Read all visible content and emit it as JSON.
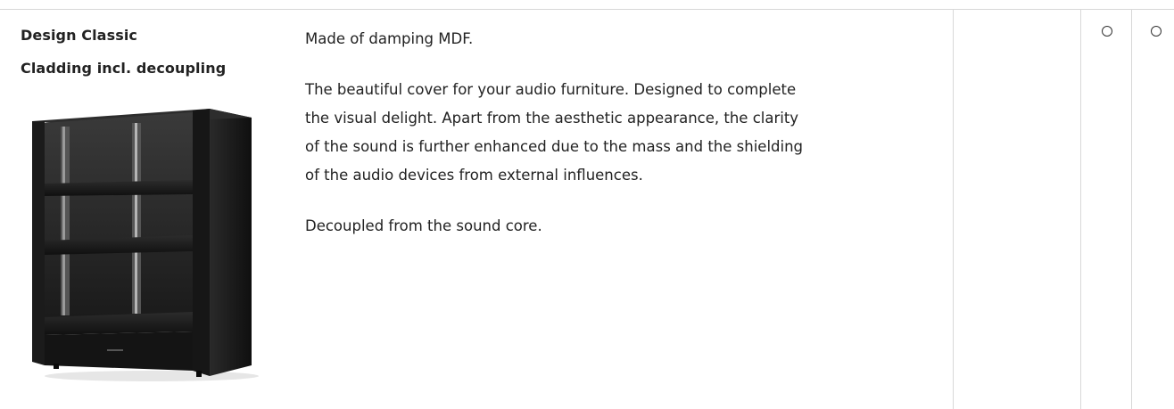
{
  "product": {
    "title_line1": "Design Classic",
    "title_line2": "Cladding incl. decoupling",
    "image_icon": "audio-rack-cladding-image"
  },
  "description": {
    "p1": "Made of damping MDF.",
    "p2_lines": [
      "The beautiful cover for your audio furniture. Designed to complete",
      "the visual delight. Apart from the aesthetic appearance, the clarity",
      "of the sound is further enhanced due to the mass and the shielding",
      "of the audio devices from external influences."
    ],
    "p3": "Decoupled from the sound core."
  },
  "availability": {
    "column_a": "optional",
    "column_b": "optional",
    "column_a_icon": "circle-outline-icon",
    "column_b_icon": "circle-outline-icon"
  },
  "colors": {
    "rule": "#d8d8d8",
    "text": "#222222",
    "cabinet": "#1c1c1c"
  }
}
